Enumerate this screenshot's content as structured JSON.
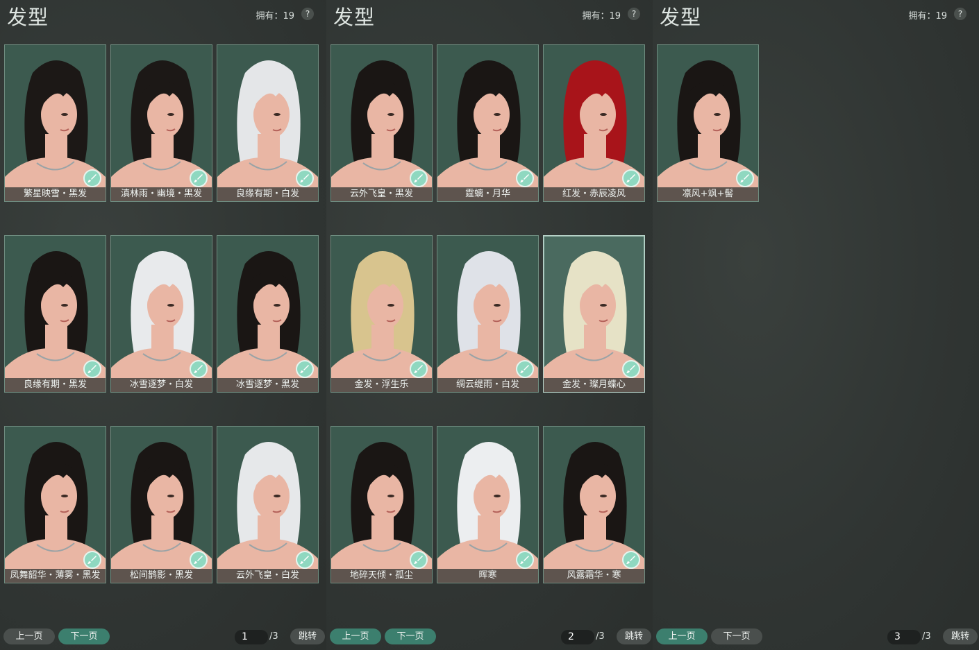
{
  "panels": [
    {
      "title": "发型",
      "owned": "拥有：19",
      "help": "?",
      "page": "1",
      "page_total": "/3",
      "prev": "上一页",
      "next": "下一页",
      "jump": "跳转",
      "items": [
        {
          "label": "繁星映雪・黑发",
          "hair": "#1c1816"
        },
        {
          "label": "滇林雨・幽境・黑发",
          "hair": "#1c1816"
        },
        {
          "label": "良缘有期・白发",
          "hair": "#e4e6e8"
        },
        {
          "label": "良缘有期・黑发",
          "hair": "#1a1614"
        },
        {
          "label": "冰雪逐梦・白发",
          "hair": "#e8eaec"
        },
        {
          "label": "冰雪逐梦・黑发",
          "hair": "#1a1614"
        },
        {
          "label": "凤舞韶华・薄雾・黑发",
          "hair": "#1a1614"
        },
        {
          "label": "松间鹊影・黑发",
          "hair": "#1a1614"
        },
        {
          "label": "云外飞皇・白发",
          "hair": "#e6e8ea"
        }
      ]
    },
    {
      "title": "发型",
      "owned": "拥有：19",
      "help": "?",
      "page": "2",
      "page_total": "/3",
      "prev": "上一页",
      "next": "下一页",
      "jump": "跳转",
      "items": [
        {
          "label": "云外飞皇・黑发",
          "hair": "#1a1614"
        },
        {
          "label": "霆螭・月华",
          "hair": "#1a1614"
        },
        {
          "label": "红发・赤辰凌风",
          "hair": "#a8141a"
        },
        {
          "label": "金发・浮生乐",
          "hair": "#d8c48e"
        },
        {
          "label": "绸云缇雨・白发",
          "hair": "#dfe2e8"
        },
        {
          "label": "金发・璨月蝶心",
          "hair": "#e6e2c6"
        },
        {
          "label": "地碎天倾・孤尘",
          "hair": "#1a1614"
        },
        {
          "label": "晖寒",
          "hair": "#eceef0"
        },
        {
          "label": "风露霜华・寒",
          "hair": "#1a1614"
        }
      ]
    },
    {
      "title": "发型",
      "owned": "拥有：19",
      "help": "?",
      "page": "3",
      "page_total": "/3",
      "prev": "上一页",
      "next": "下一页",
      "jump": "跳转",
      "items": [
        {
          "label": "凛风+飒+髻",
          "hair": "#1a1614"
        }
      ]
    }
  ],
  "selected": {
    "panel": 1,
    "item": 5
  },
  "colors": {
    "skin": "#e9b6a4",
    "card_bg": "#3c5a4f",
    "accent": "#3c7f6e",
    "dye_icon": "#8fd8c0"
  },
  "icons": {
    "dye": "dye-brush-icon",
    "help": "help-icon"
  }
}
